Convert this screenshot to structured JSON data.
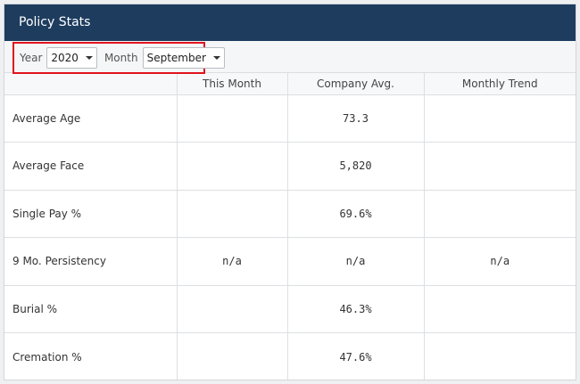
{
  "header": {
    "title": "Policy Stats"
  },
  "filters": {
    "year_label": "Year",
    "year_value": "2020",
    "month_label": "Month",
    "month_value": "September"
  },
  "table": {
    "columns": [
      "",
      "This Month",
      "Company Avg.",
      "Monthly Trend"
    ],
    "rows": [
      {
        "metric": "Average Age",
        "this_month": "",
        "company_avg": "73.3",
        "monthly_trend": ""
      },
      {
        "metric": "Average Face",
        "this_month": "",
        "company_avg": "5,820",
        "monthly_trend": ""
      },
      {
        "metric": "Single Pay %",
        "this_month": "",
        "company_avg": "69.6%",
        "monthly_trend": ""
      },
      {
        "metric": "9 Mo. Persistency",
        "this_month": "n/a",
        "company_avg": "n/a",
        "monthly_trend": "n/a"
      },
      {
        "metric": "Burial %",
        "this_month": "",
        "company_avg": "46.3%",
        "monthly_trend": ""
      },
      {
        "metric": "Cremation %",
        "this_month": "",
        "company_avg": "47.6%",
        "monthly_trend": ""
      }
    ]
  },
  "colors": {
    "header_bg": "#1d3c5e",
    "highlight_border": "#e0141e"
  }
}
